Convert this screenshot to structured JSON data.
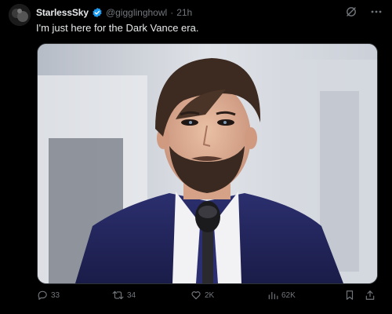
{
  "tweet": {
    "author_name": "StarlessSky",
    "handle": "@gigglinghowl",
    "separator": "·",
    "time": "21h",
    "text": "I'm just here for the Dark Vance era."
  },
  "actions": {
    "replies": "33",
    "retweets": "34",
    "likes": "2K",
    "views": "62K"
  },
  "icons": [
    "verified-icon",
    "grok-icon",
    "more-icon",
    "reply-icon",
    "retweet-icon",
    "like-icon",
    "views-icon",
    "bookmark-icon",
    "share-icon"
  ],
  "colors": {
    "verified": "#1d9bf0",
    "muted": "#71767b",
    "text": "#e7e9ea",
    "background": "#000000"
  }
}
